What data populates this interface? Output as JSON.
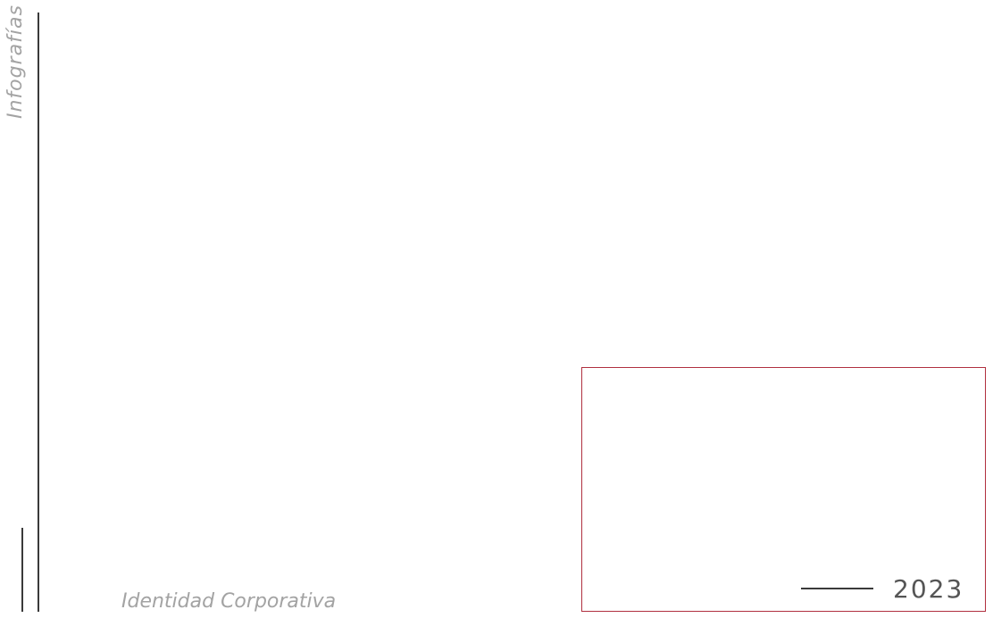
{
  "side_title": "Infografías",
  "footer_title": "Identidad Corporativa",
  "year": "2023",
  "colors": {
    "accent_frame": "#b0303f",
    "rules": "#3a3a3a",
    "muted_text": "#a3a3a3",
    "year_text": "#555555"
  }
}
